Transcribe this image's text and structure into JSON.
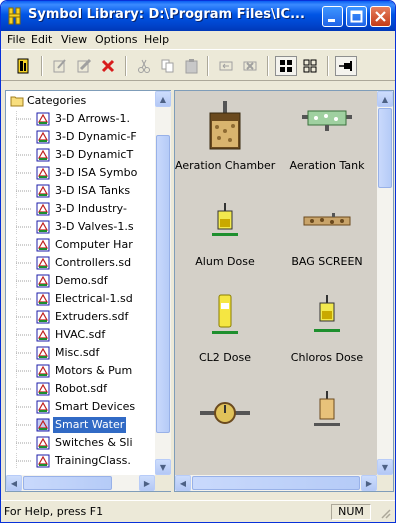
{
  "window": {
    "title": "Symbol Library: D:\\Program Files\\IC..."
  },
  "menu": [
    "File",
    "Edit",
    "View",
    "Options",
    "Help"
  ],
  "toolbar": {
    "icons": [
      "library-icon",
      "edit-icon",
      "edit-properties-icon",
      "delete-icon",
      "cut-icon",
      "copy-icon",
      "paste-icon",
      "undo-icon",
      "clear-icon",
      "large-icons-icon",
      "small-icons-icon",
      "pin-icon"
    ]
  },
  "tree": {
    "root": "Categories",
    "items": [
      "3-D Arrows-1.",
      "3-D Dynamic-F",
      "3-D DynamicT",
      "3-D ISA Symbo",
      "3-D ISA Tanks",
      "3-D Industry-",
      "3-D Valves-1.s",
      "Computer Har",
      "Controllers.sd",
      "Demo.sdf",
      "Electrical-1.sd",
      "Extruders.sdf",
      "HVAC.sdf",
      "Misc.sdf",
      "Motors & Pum",
      "Robot.sdf",
      "Smart Devices",
      "Smart Water",
      "Switches & Sli",
      "TrainingClass."
    ],
    "selected": "Smart Water"
  },
  "symbols": [
    {
      "label": "Aeration Chamber",
      "icon": "aeration-chamber-icon"
    },
    {
      "label": "Aeration Tank",
      "icon": "aeration-tank-icon"
    },
    {
      "label": "Alum Dose",
      "icon": "alum-dose-icon"
    },
    {
      "label": "BAG SCREEN",
      "icon": "bag-screen-icon"
    },
    {
      "label": "CL2 Dose",
      "icon": "cl2-dose-icon"
    },
    {
      "label": "Chloros Dose",
      "icon": "chloros-dose-icon"
    },
    {
      "label": "",
      "icon": "flow-meter-icon"
    },
    {
      "label": "",
      "icon": "dosing-unit-icon"
    }
  ],
  "status": {
    "help": "For Help, press F1",
    "num": "NUM"
  }
}
